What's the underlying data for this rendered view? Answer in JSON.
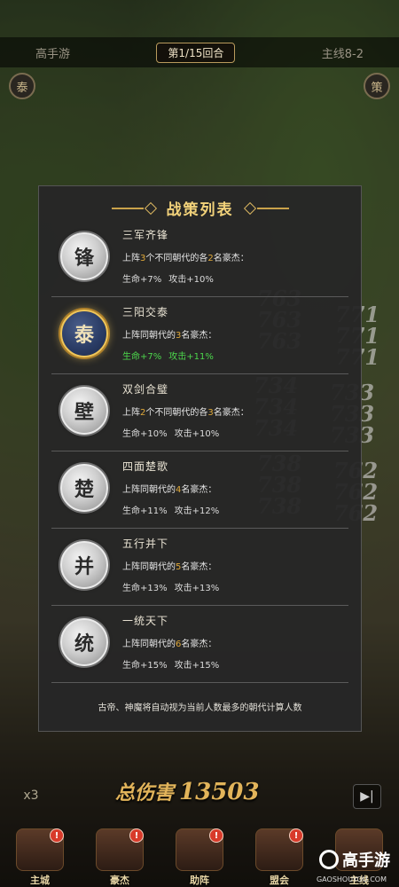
{
  "header": {
    "left_label": "高手游",
    "round_label": "第1/15回合",
    "right_label": "主线8-2"
  },
  "corner_buttons": {
    "left": "泰",
    "right": "策"
  },
  "background_numbers": [
    "763",
    "771",
    "763",
    "771",
    "763",
    "771",
    "734",
    "733",
    "734",
    "733",
    "734",
    "733",
    "738",
    "762",
    "738",
    "762",
    "738",
    "762"
  ],
  "panel": {
    "title": "战策列表",
    "strategies": [
      {
        "icon": "锋",
        "name": "三军齐锋",
        "desc": [
          "上阵",
          "3",
          "个不同朝代的各",
          "2",
          "名豪杰："
        ],
        "hp": "生命+7%",
        "atk": "攻击+10%",
        "active": false
      },
      {
        "icon": "泰",
        "name": "三阳交泰",
        "desc": [
          "上阵同朝代的",
          "3",
          "名豪杰：",
          "",
          ""
        ],
        "hp": "生命+7%",
        "atk": "攻击+11%",
        "active": true
      },
      {
        "icon": "壁",
        "name": "双剑合璧",
        "desc": [
          "上阵",
          "2",
          "个不同朝代的各",
          "3",
          "名豪杰："
        ],
        "hp": "生命+10%",
        "atk": "攻击+10%",
        "active": false
      },
      {
        "icon": "楚",
        "name": "四面楚歌",
        "desc": [
          "上阵同朝代的",
          "4",
          "名豪杰：",
          "",
          ""
        ],
        "hp": "生命+11%",
        "atk": "攻击+12%",
        "active": false
      },
      {
        "icon": "并",
        "name": "五行并下",
        "desc": [
          "上阵同朝代的",
          "5",
          "名豪杰：",
          "",
          ""
        ],
        "hp": "生命+13%",
        "atk": "攻击+13%",
        "active": false
      },
      {
        "icon": "统",
        "name": "一统天下",
        "desc": [
          "上阵同朝代的",
          "6",
          "名豪杰：",
          "",
          ""
        ],
        "hp": "生命+15%",
        "atk": "攻击+15%",
        "active": false
      }
    ],
    "note": "古帝、神魔将自动视为当前人数最多的朝代计算人数"
  },
  "hud": {
    "speed": "x3",
    "total_label": "总伤害",
    "total_value": "13503",
    "skip": "▶|"
  },
  "nav": [
    {
      "label": "主城",
      "badge": "!"
    },
    {
      "label": "豪杰",
      "badge": "!"
    },
    {
      "label": "助阵",
      "badge": "!"
    },
    {
      "label": "盟会",
      "badge": "!"
    },
    {
      "label": "主线",
      "badge": ""
    }
  ],
  "watermark": {
    "text": "高手游",
    "sub": "GAOSHOUYOU.COM"
  }
}
